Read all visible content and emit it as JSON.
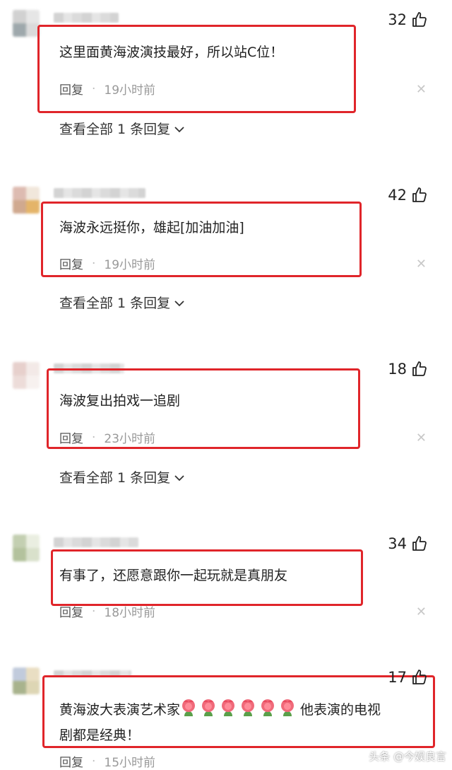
{
  "comments": [
    {
      "likes": "32",
      "text": "这里面黄海波演技最好，所以站C位！",
      "reply_label": "回复",
      "time": "19小时前",
      "view_replies": "查看全部 1 条回复"
    },
    {
      "likes": "42",
      "text": "海波永远挺你，雄起[加油加油]",
      "reply_label": "回复",
      "time": "19小时前",
      "view_replies": "查看全部 1 条回复"
    },
    {
      "likes": "18",
      "text": "海波复出拍戏一追剧",
      "reply_label": "回复",
      "time": "23小时前",
      "view_replies": "查看全部 1 条回复"
    },
    {
      "likes": "34",
      "text": "有事了，还愿意跟你一起玩就是真朋友",
      "reply_label": "回复",
      "time": "18小时前"
    },
    {
      "likes": "17",
      "text_part1": "黄海波大表演艺术家",
      "text_part2": "他表演的电视",
      "text_line2": "剧都是经典！",
      "reply_label": "回复",
      "time": "15小时前"
    }
  ],
  "watermark": "头条 @今娱良言",
  "colors": {
    "highlight_border": "#e0252a",
    "meta_gray": "#999999"
  },
  "icons": {
    "like": "thumbs-up-icon",
    "close": "close-icon",
    "expand": "chevron-down-icon",
    "emoji": "tulip-emoji"
  }
}
